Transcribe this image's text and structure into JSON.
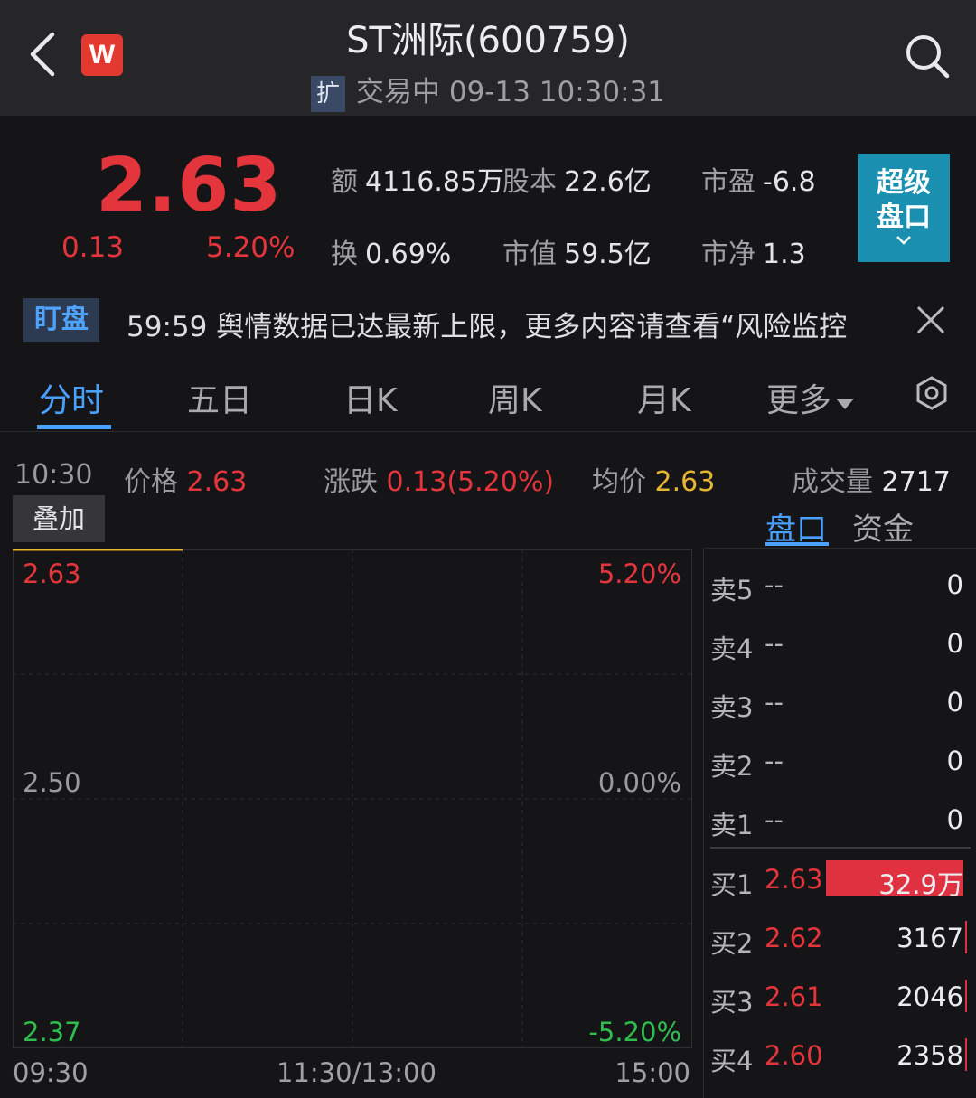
{
  "header": {
    "title": "ST洲际(600759)",
    "extension_tag": "扩",
    "status_line": "交易中 09-13 10:30:31",
    "logo_letter": "W"
  },
  "quote": {
    "price": "2.63",
    "change": "0.13",
    "change_pct": "5.20%",
    "amount_label": "额",
    "amount": "4116.85万",
    "share_capital_label": "股本",
    "share_capital": "22.6亿",
    "pe_label": "市盈",
    "pe": "-6.8",
    "turnover_label": "换",
    "turnover": "0.69%",
    "market_cap_label": "市值",
    "market_cap": "59.5亿",
    "pb_label": "市净",
    "pb": "1.3",
    "super_button_line1": "超级",
    "super_button_line2": "盘口"
  },
  "ticker": {
    "watch_label": "盯盘",
    "text": "59:59 舆情数据已达最新上限，更多内容请查看“风险监控"
  },
  "tabs": [
    "分时",
    "五日",
    "日K",
    "周K",
    "月K",
    "更多"
  ],
  "info_row": {
    "time": "10:30",
    "price_label": "价格",
    "price": "2.63",
    "change_label": "涨跌",
    "change": "0.13(5.20%)",
    "avg_label": "均价",
    "avg": "2.63",
    "volume_label": "成交量",
    "volume": "2717"
  },
  "overlay_button": "叠加",
  "panel_tabs": [
    "盘口",
    "资金"
  ],
  "chart_data": {
    "type": "line",
    "y_left_ticks": [
      "2.63",
      "2.50",
      "2.37"
    ],
    "y_right_ticks": [
      "5.20%",
      "0.00%",
      "-5.20%"
    ],
    "x_ticks": [
      "09:30",
      "11:30/13:00",
      "15:00"
    ],
    "ylim": [
      2.37,
      2.63
    ],
    "x": [
      "09:30",
      "10:30"
    ],
    "series": [
      {
        "values": [
          2.63,
          2.63
        ],
        "color": "#e8b530"
      }
    ],
    "grid": true
  },
  "order_book": {
    "sell": [
      {
        "label": "卖5",
        "price": "--",
        "volume": "0"
      },
      {
        "label": "卖4",
        "price": "--",
        "volume": "0"
      },
      {
        "label": "卖3",
        "price": "--",
        "volume": "0"
      },
      {
        "label": "卖2",
        "price": "--",
        "volume": "0"
      },
      {
        "label": "卖1",
        "price": "--",
        "volume": "0"
      }
    ],
    "buy": [
      {
        "label": "买1",
        "price": "2.63",
        "volume": "32.9万"
      },
      {
        "label": "买2",
        "price": "2.62",
        "volume": "3167"
      },
      {
        "label": "买3",
        "price": "2.61",
        "volume": "2046"
      },
      {
        "label": "买4",
        "price": "2.60",
        "volume": "2358"
      }
    ]
  },
  "colors": {
    "up": "#e5353c",
    "down": "#2fbd4f",
    "avg": "#e8b530",
    "accent": "#4aa0ff",
    "super_button": "#1b8fb0"
  }
}
